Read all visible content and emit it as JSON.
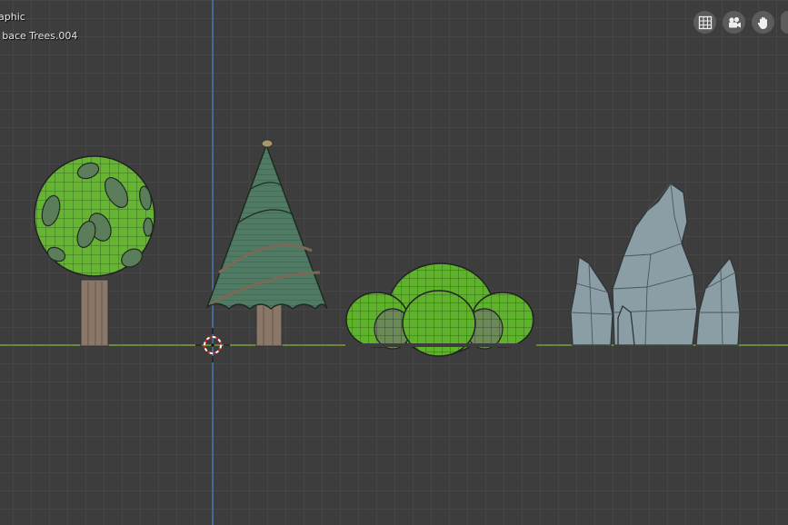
{
  "viewport": {
    "view_name": "aphic",
    "object_name": "o bace Trees.004"
  },
  "nav": {
    "icons": [
      "grid-icon",
      "camera-icon",
      "hand-icon",
      "partial-button"
    ]
  },
  "colors": {
    "background": "#3d3d3d",
    "grid_line": "#464646",
    "ground_line": "#8ab035",
    "z_axis": "#4c7ac4",
    "foliage": "#66b532",
    "pine": "#4f7a63",
    "trunk": "#8a7768",
    "rock": "#8c9ea5"
  }
}
